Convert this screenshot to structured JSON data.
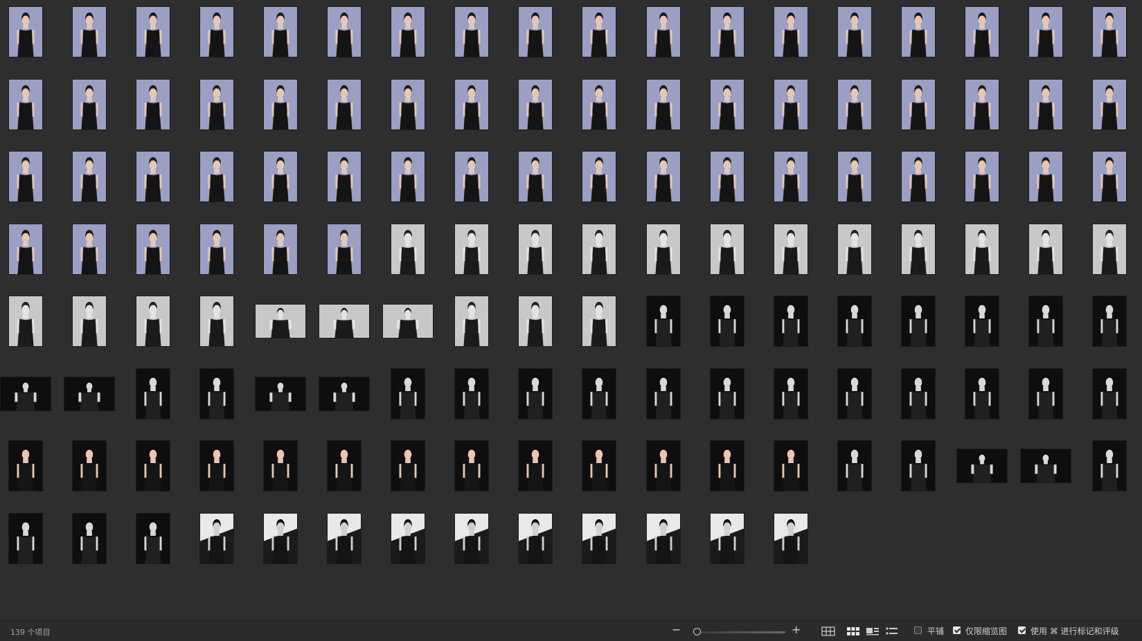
{
  "library": {
    "item_count_label": "139 个项目",
    "rows": [
      [
        "pc",
        "pc",
        "pc",
        "pc",
        "pc",
        "pc",
        "pc",
        "pc",
        "pc",
        "pc",
        "pc",
        "pc",
        "pc",
        "pc",
        "pc",
        "pc",
        "pc",
        "pc"
      ],
      [
        "pc",
        "pc",
        "pc",
        "pc",
        "pc",
        "pc",
        "pc",
        "pc",
        "pc",
        "pc",
        "pc",
        "pc",
        "pc",
        "pc",
        "pc",
        "pc",
        "pc",
        "pc"
      ],
      [
        "pc",
        "pc",
        "pc",
        "pc",
        "pc",
        "pc",
        "pc",
        "pc",
        "pc",
        "pc",
        "pc",
        "pc",
        "pc",
        "pc",
        "pc",
        "pc",
        "pc",
        "pc"
      ],
      [
        "pc",
        "pc",
        "pc",
        "pc",
        "pc",
        "pc",
        "gp",
        "gp",
        "gp",
        "gp",
        "gp",
        "gp",
        "gp",
        "gp",
        "gp",
        "gp",
        "gp",
        "gp"
      ],
      [
        "gp",
        "gp",
        "gp",
        "gp",
        "gl",
        "gl",
        "gl",
        "gp",
        "gp",
        "gp",
        "kp",
        "kp",
        "kp",
        "kp",
        "kp",
        "kp",
        "kp",
        "kp"
      ],
      [
        "kl",
        "kl",
        "kp",
        "kp",
        "kl",
        "kl",
        "kp",
        "kp",
        "kp",
        "kp",
        "kp",
        "kp",
        "kp",
        "kp",
        "kp",
        "kp",
        "kp",
        "kp"
      ],
      [
        "cp",
        "cp",
        "cp",
        "cp",
        "cp",
        "cp",
        "cp",
        "cp",
        "cp",
        "cp",
        "cp",
        "cp",
        "cp",
        "kp",
        "kp",
        "kl",
        "kl",
        "kp"
      ],
      [
        "kp",
        "kp",
        "kp",
        "wp",
        "wp",
        "wp",
        "wp",
        "wp",
        "wp",
        "wp",
        "wp",
        "wp",
        "wp"
      ]
    ]
  },
  "statusbar": {
    "zoom_out_label": "−",
    "zoom_in_label": "+",
    "zoom_level": 0.02,
    "tile_label": "平铺",
    "tile_checked": false,
    "thumbs_only_label": "仅限缩览图",
    "thumbs_only_checked": true,
    "cmd_rating_label": "使用 ⌘ 进行标记和评级",
    "cmd_rating_checked": true,
    "icons": [
      "zoom-out-icon",
      "zoom-in-icon",
      "grid-small-icon",
      "grid-large-icon",
      "filmstrip-icon",
      "list-icon"
    ]
  },
  "colors": {
    "background": "#2e2e2e",
    "statusbar": "#2b2b2b",
    "photo_color_bg": "#9b9fc4",
    "photo_gray_bg": "#c8c8c8",
    "photo_black_bg": "#0e0e0e",
    "photo_white_bg": "#e9e9e9",
    "dress": "#141414",
    "skin": "#e7c6b2"
  }
}
